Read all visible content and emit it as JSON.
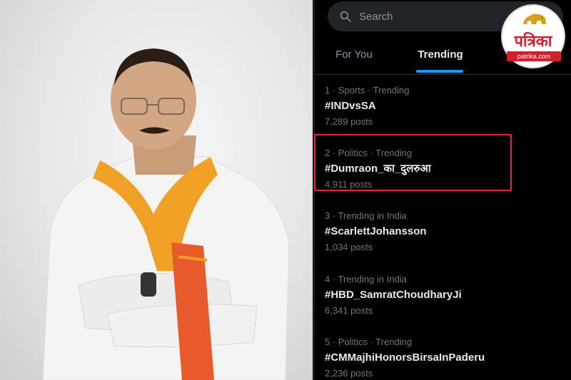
{
  "search": {
    "placeholder": "Search"
  },
  "tabs": [
    {
      "label": "For You",
      "active": false
    },
    {
      "label": "Trending",
      "active": true
    }
  ],
  "trends": [
    {
      "meta": "1 · Sports · Trending",
      "tag": "#INDvsSA",
      "count": "7,289 posts"
    },
    {
      "meta": "2 · Politics · Trending",
      "tag": "#Dumraon_का_दुलरुआ",
      "count": "4,911 posts"
    },
    {
      "meta": "3 · Trending in India",
      "tag": "#ScarlettJohansson",
      "count": "1,034 posts"
    },
    {
      "meta": "4 · Trending in India",
      "tag": "#HBD_SamratChoudharyJi",
      "count": "6,341 posts"
    },
    {
      "meta": "5 · Politics · Trending",
      "tag": "#CMMajhiHonorsBirsaInPaderu",
      "count": "2,236 posts"
    }
  ],
  "logo": {
    "name": "पत्रिका",
    "url": "patrika.com"
  },
  "colors": {
    "accent": "#1d9bf0",
    "highlight": "#e0273a",
    "brand": "#d31f2b"
  }
}
